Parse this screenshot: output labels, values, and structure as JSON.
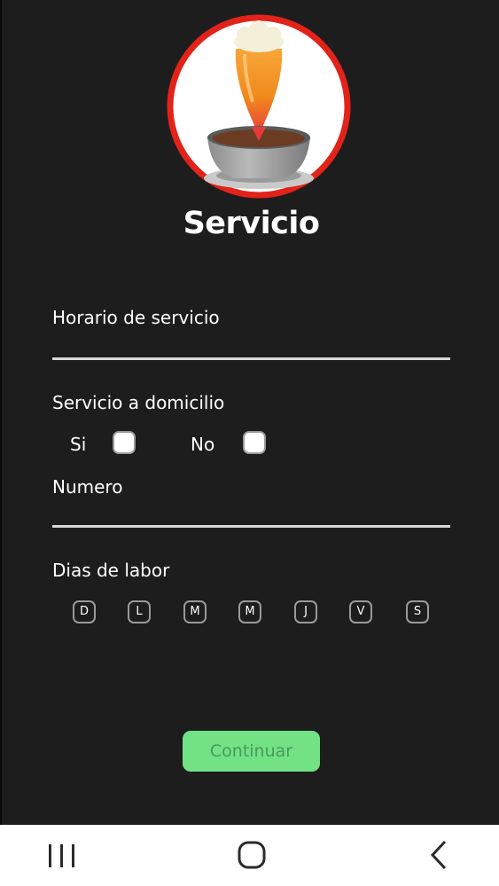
{
  "header": {
    "title": "Servicio",
    "logo_icon": "cafe-beer-pin-logo"
  },
  "form": {
    "horario": {
      "label": "Horario de servicio",
      "value": ""
    },
    "domicilio": {
      "label": "Servicio a domicilio",
      "options": [
        {
          "label": "Si",
          "checked": false
        },
        {
          "label": "No",
          "checked": false
        }
      ]
    },
    "numero": {
      "label": "Numero",
      "value": ""
    },
    "dias": {
      "label": "Dias de labor",
      "days": [
        "D",
        "L",
        "M",
        "M",
        "J",
        "V",
        "S"
      ]
    }
  },
  "actions": {
    "continue_label": "Continuar"
  },
  "colors": {
    "background": "#1e1d1e",
    "logo_ring": "#e2231a",
    "button": "#72e285",
    "button_text": "#4a9a5a"
  },
  "system_nav": {
    "recents_icon": "recents-icon",
    "home_icon": "home-icon",
    "back_icon": "back-icon"
  }
}
